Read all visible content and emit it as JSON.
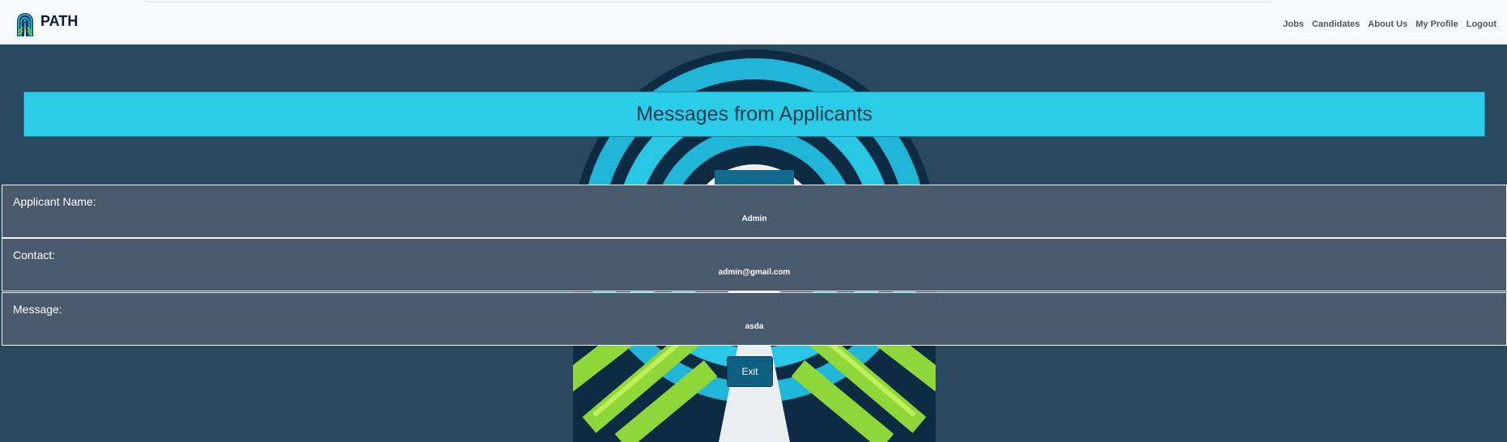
{
  "navbar": {
    "brand": "PATH",
    "links": [
      "Jobs",
      "Candidates",
      "About Us",
      "My Profile",
      "Logout"
    ]
  },
  "page": {
    "title": "Messages from Applicants"
  },
  "message": {
    "fields": [
      {
        "label": "Applicant Name:",
        "value": "Admin"
      },
      {
        "label": "Contact:",
        "value": "admin@gmail.com"
      },
      {
        "label": "Message:",
        "value": "asda"
      }
    ]
  },
  "actions": {
    "exit_label": "Exit"
  },
  "colors": {
    "navbar_bg": "#f8f9fa",
    "page_bg": "#294a5e",
    "banner": "#2acce8",
    "row_bg": "#485a6b",
    "button_bg": "#0f5f80"
  }
}
